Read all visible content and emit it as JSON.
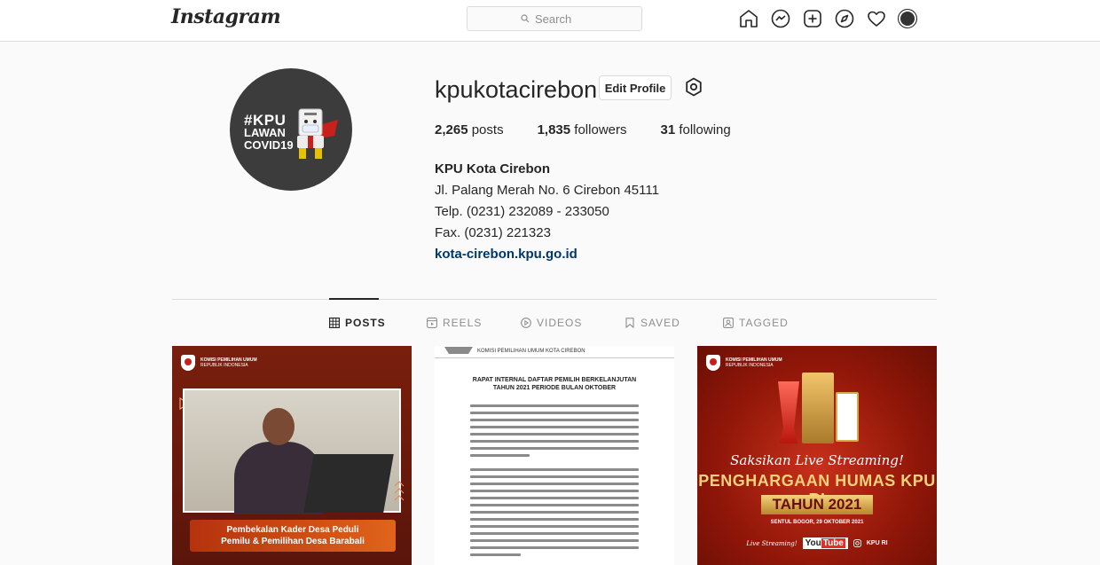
{
  "header": {
    "logo": "Instagram",
    "search_placeholder": "Search",
    "nav_icons": [
      "home-icon",
      "messenger-icon",
      "new-post-icon",
      "explore-icon",
      "activity-icon",
      "profile-avatar"
    ]
  },
  "profile": {
    "username": "kpukotacirebon",
    "edit_profile_label": "Edit Profile",
    "avatar_text": {
      "line1": "#KPU",
      "line2": "LAWAN",
      "line3": "COVID19"
    },
    "stats": {
      "posts_count": "2,265",
      "posts_label": "posts",
      "followers_count": "1,835",
      "followers_label": "followers",
      "following_count": "31",
      "following_label": "following"
    },
    "bio": {
      "name": "KPU Kota Cirebon",
      "address": "Jl. Palang Merah No. 6 Cirebon 45111",
      "phone": "Telp. (0231) 232089 - 233050",
      "fax": "Fax. (0231) 221323",
      "website": "kota-cirebon.kpu.go.id"
    }
  },
  "tabs": [
    {
      "label": "POSTS",
      "icon": "grid-icon",
      "active": true
    },
    {
      "label": "REELS",
      "icon": "reels-icon",
      "active": false
    },
    {
      "label": "VIDEOS",
      "icon": "video-icon",
      "active": false
    },
    {
      "label": "SAVED",
      "icon": "bookmark-icon",
      "active": false
    },
    {
      "label": "TAGGED",
      "icon": "tag-icon",
      "active": false
    }
  ],
  "posts": [
    {
      "org": "KOMISI PEMILIHAN UMUM",
      "org_sub": "REPUBLIK INDONESIA",
      "caption_line1": "Pembekalan Kader Desa Peduli",
      "caption_line2": "Pemilu & Pemilihan Desa Barabali"
    },
    {
      "org": "KOMISI PEMILIHAN UMUM KOTA CIREBON",
      "title_line1": "RAPAT INTERNAL DAFTAR PEMILIH BERKELANJUTAN",
      "title_line2": "TAHUN 2021 PERIODE BULAN OKTOBER"
    },
    {
      "org": "KOMISI PEMILIHAN UMUM",
      "org_sub": "REPUBLIK INDONESIA",
      "script_text": "Saksikan Live Streaming!",
      "headline": "PENGHARGAAN HUMAS KPU RI",
      "year": "TAHUN 2021",
      "date": "SENTUL BOGOR, 29 OKTOBER 2021",
      "footer_live": "Live Streaming!",
      "footer_you": "You",
      "footer_tube": "Tube",
      "footer_channel": "KPU RI"
    }
  ]
}
